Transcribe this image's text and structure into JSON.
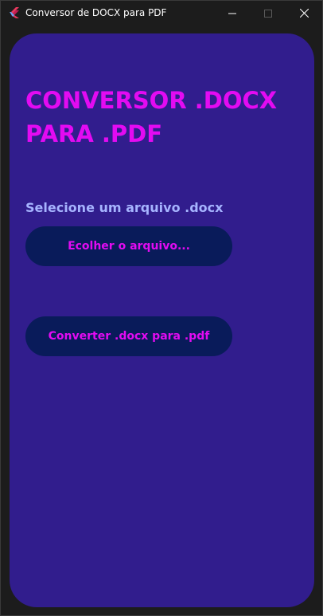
{
  "window": {
    "title": "Conversor de DOCX para PDF",
    "icons": {
      "app": "flutter-logo-icon",
      "minimize": "minimize-icon",
      "maximize": "maximize-icon",
      "close": "close-icon"
    }
  },
  "main": {
    "heading": "CONVERSOR .DOCX PARA .PDF",
    "select_label": "Selecione um arquivo .docx",
    "choose_button": "Ecolher o arquivo...",
    "convert_button": "Converter .docx para .pdf"
  },
  "colors": {
    "window_bg": "#1c1c1c",
    "card_bg": "#311d8d",
    "heading": "#e30bf2",
    "label": "#a6b4ff",
    "button_bg": "#091b5a",
    "button_text": "#e30bf2"
  }
}
